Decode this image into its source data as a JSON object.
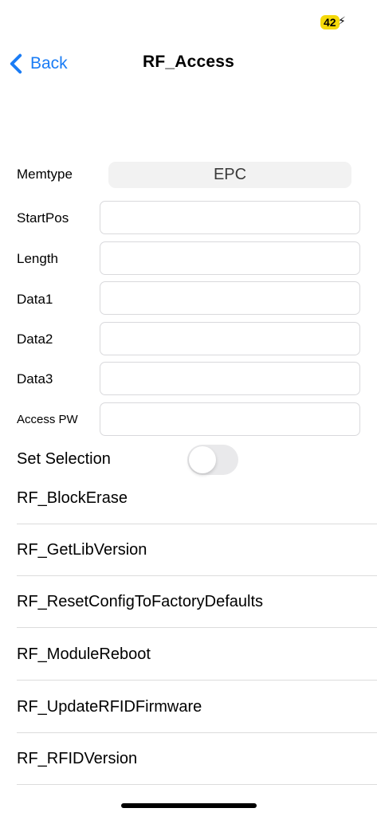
{
  "status_bar": {
    "battery": "42"
  },
  "nav": {
    "back_label": "Back",
    "title": "RF_Access"
  },
  "form": {
    "memtype_label": "Memtype",
    "memtype_value": "EPC",
    "startpos_label": "StartPos",
    "length_label": "Length",
    "data1_label": "Data1",
    "data2_label": "Data2",
    "data3_label": "Data3",
    "accesspw_label": "Access PW",
    "startpos_value": "",
    "length_value": "",
    "data1_value": "",
    "data2_value": "",
    "data3_value": "",
    "accesspw_value": ""
  },
  "set_selection": {
    "label": "Set Selection",
    "enabled": false
  },
  "list": {
    "items": [
      "RF_BlockErase",
      "RF_GetLibVersion",
      "RF_ResetConfigToFactoryDefaults",
      "RF_ModuleReboot",
      "RF_UpdateRFIDFirmware",
      "RF_RFIDVersion"
    ]
  },
  "colors": {
    "accent": "#1a7cf5",
    "battery": "#f5d90a"
  }
}
